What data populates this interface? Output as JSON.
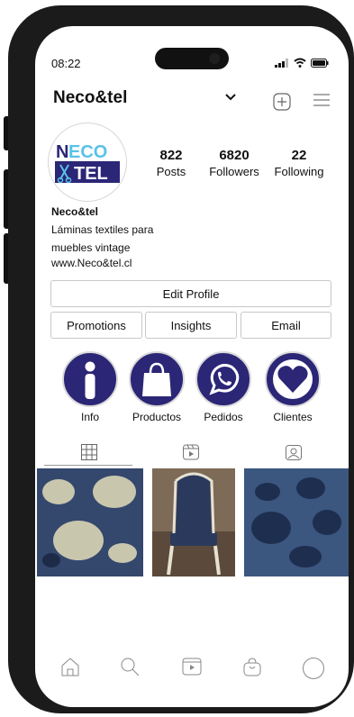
{
  "status": {
    "time": "08:22"
  },
  "profile": {
    "username": "Neco&tel",
    "logo_text": [
      "NECO",
      "TEL"
    ],
    "stats": [
      {
        "value": "822",
        "label": "Posts"
      },
      {
        "value": "6820",
        "label": "Followers"
      },
      {
        "value": "22",
        "label": "Following"
      }
    ],
    "name": "Neco&tel",
    "bio_lines": [
      "Láminas textiles para",
      "muebles vintage"
    ],
    "website": "www.Neco&tel.cl"
  },
  "actions": {
    "edit_profile": "Edit Profile",
    "promotions": "Promotions",
    "insights": "Insights",
    "email": "Email"
  },
  "highlights": [
    {
      "label": "Info",
      "icon": "info-icon"
    },
    {
      "label": "Productos",
      "icon": "shopping-bag-icon"
    },
    {
      "label": "Pedidos",
      "icon": "whatsapp-icon"
    },
    {
      "label": "Clientes",
      "icon": "heart-icon"
    }
  ],
  "tabs": [
    "grid-icon",
    "reels-icon",
    "tagged-icon"
  ],
  "colors": {
    "brand": "#2b2676",
    "logo_cyan": "#58c3e8"
  },
  "bottom_nav": [
    "home-icon",
    "search-icon",
    "reels-icon",
    "shop-icon",
    "profile-icon"
  ]
}
